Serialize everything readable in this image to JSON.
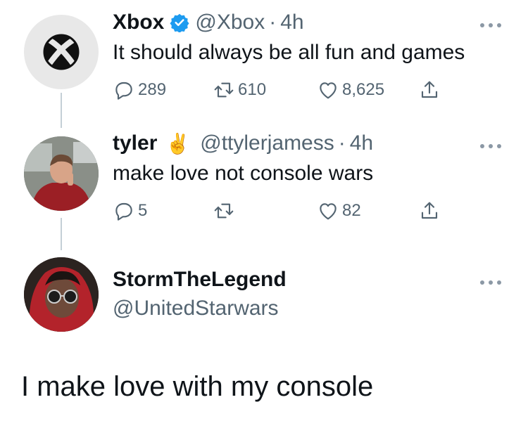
{
  "tweet1": {
    "name": "Xbox",
    "handle": "@Xbox",
    "separator": "·",
    "time": "4h",
    "text": "It should always be all fun and games",
    "replies": "289",
    "retweets": "610",
    "likes": "8,625",
    "avatar_icon": "xbox-logo-icon",
    "verified_icon": "verified-badge-icon",
    "verified_color": "#1d9bf0"
  },
  "tweet2": {
    "name": "tyler",
    "emoji": "✌️",
    "handle": "@ttylerjamess",
    "separator": "·",
    "time": "4h",
    "text": "make love not console wars",
    "replies": "5",
    "likes": "82",
    "avatar_icon": "user-photo-icon"
  },
  "tweet3": {
    "name": "StormTheLegend",
    "handle": "@UnitedStarwars",
    "avatar_icon": "user-photo-icon"
  },
  "reply": {
    "text": "I make love with my console"
  },
  "colors": {
    "text": "#0f1419",
    "secondary": "#536471",
    "thread_line": "#c4cfd6"
  }
}
